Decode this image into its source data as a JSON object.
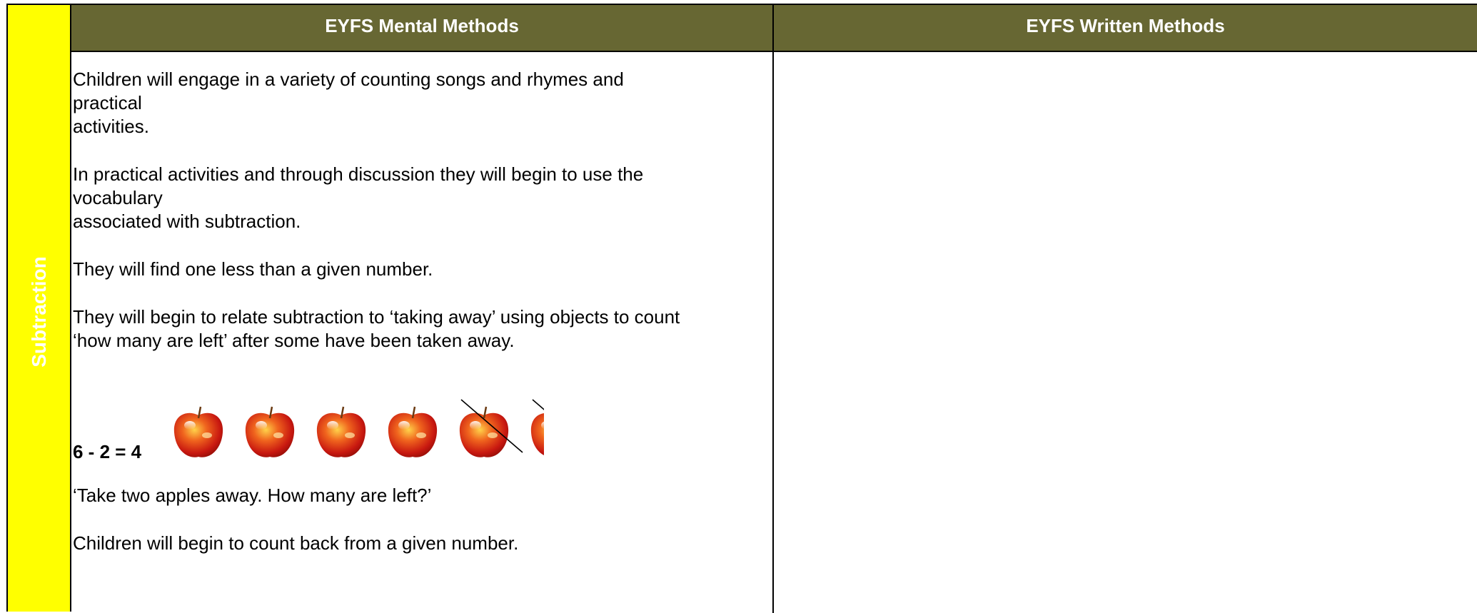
{
  "side_label": "Subtraction",
  "header": {
    "mental": "EYFS Mental Methods",
    "written": "EYFS Written Methods"
  },
  "mental": {
    "p1": [
      "Children will engage in a variety of counting songs and rhymes and",
      "practical",
      "activities."
    ],
    "p2": [
      "In practical activities and through discussion they will begin to use the",
      "vocabulary",
      "associated with subtraction."
    ],
    "p3": "They will find one less than a given number.",
    "p4": [
      "They will begin to relate subtraction to ‘taking away’ using objects to count",
      "‘how many are left’ after some have been taken away."
    ],
    "equation": "6 - 2 = 4",
    "apples": {
      "total": 6,
      "crossed_out": 2,
      "icon": "apple-icon"
    },
    "p5": "‘Take two apples away. How many are left?’",
    "p6": "Children will begin to count back from a given number."
  },
  "written": {}
}
